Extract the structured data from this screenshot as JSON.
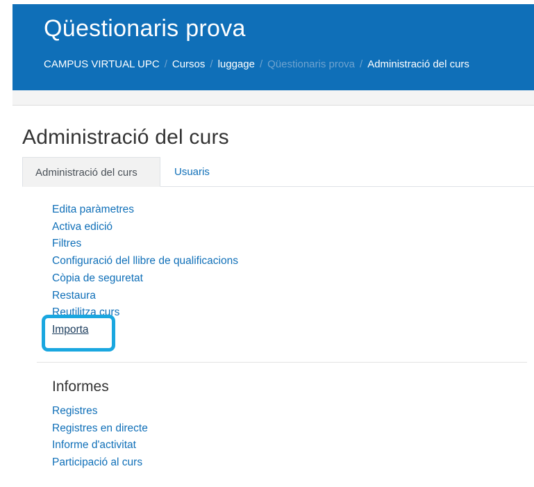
{
  "header": {
    "course_title": "Qüestionaris prova",
    "breadcrumb": [
      {
        "label": "CAMPUS VIRTUAL UPC"
      },
      {
        "label": "Cursos"
      },
      {
        "label": "luggage"
      },
      {
        "label": "Qüestionaris prova"
      },
      {
        "label": "Administració del curs"
      }
    ],
    "separator": "/"
  },
  "page_heading": "Administració del curs",
  "tabs": [
    {
      "label": "Administració del curs",
      "active": true
    },
    {
      "label": "Usuaris",
      "active": false
    }
  ],
  "admin_links": [
    "Edita paràmetres",
    "Activa edició",
    "Filtres",
    "Configuració del llibre de qualificacions",
    "Còpia de seguretat",
    "Restaura",
    "Reutilitza curs",
    "Importa"
  ],
  "reports": {
    "title": "Informes",
    "links": [
      "Registres",
      "Registres en directe",
      "Informe d'activitat",
      "Participació al curs"
    ]
  },
  "colors": {
    "header_bg": "#0f6fb8",
    "link": "#0f6fb8",
    "highlight": "#1aa7e0"
  }
}
